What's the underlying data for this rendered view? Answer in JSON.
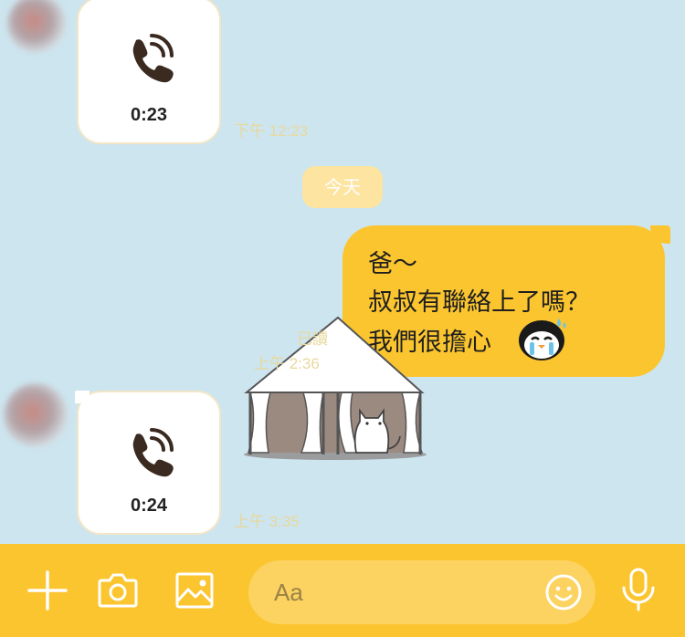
{
  "messages": {
    "call1": {
      "duration": "0:23",
      "time": "下午 12:23"
    },
    "date_divider": "今天",
    "outgoing": {
      "lines": [
        "爸～",
        "叔叔有聯絡上了嗎？",
        "我們很擔心"
      ],
      "read_status": "已讀",
      "time": "上午 2:36"
    },
    "call2": {
      "duration": "0:24",
      "time": "上午 3:35"
    }
  },
  "input": {
    "placeholder": "Aa"
  },
  "icons": {
    "call": "phone-call-icon",
    "penguin": "crying-penguin-emoji",
    "sticker": "cat-in-tent-sticker",
    "add": "plus-icon",
    "camera": "camera-icon",
    "image": "image-icon",
    "emoji": "smiley-icon",
    "mic": "microphone-icon"
  },
  "colors": {
    "background": "#cde5ef",
    "outgoing_bubble": "#fbc52f",
    "bar": "#fbc52f",
    "timestamp": "#e8d89d"
  }
}
